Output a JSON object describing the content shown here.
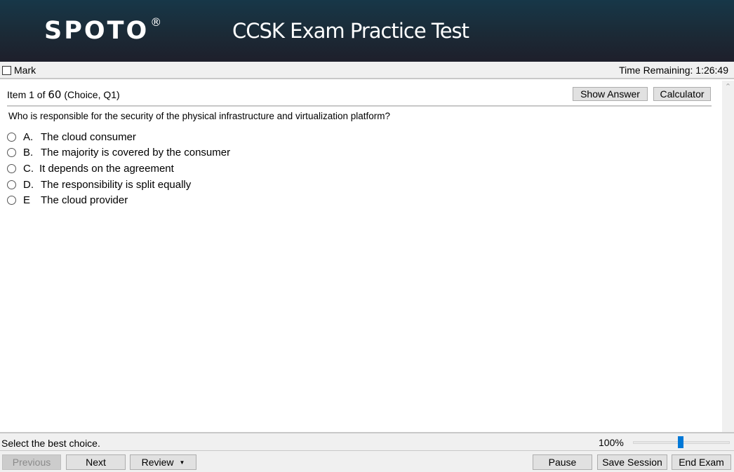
{
  "header": {
    "logo": "SPOTO",
    "logo_mark": "®",
    "title": "CCSK Exam Practice Test"
  },
  "markbar": {
    "mark_label": "Mark",
    "mark_checked": false,
    "time_remaining": "Time Remaining: 1:26:49"
  },
  "item": {
    "prefix": "Item 1 of",
    "total": "60",
    "suffix": "(Choice, Q1)",
    "show_answer_label": "Show Answer",
    "calculator_label": "Calculator"
  },
  "question": {
    "text": "Who is responsible for the security of the physical infrastructure and virtualization platform?",
    "options": [
      {
        "letter": "A.",
        "text": "The cloud consumer",
        "selected": false
      },
      {
        "letter": "B.",
        "text": "The majority is covered by the consumer",
        "selected": false
      },
      {
        "letter": "C.",
        "text": "It depends on the agreement",
        "selected": false
      },
      {
        "letter": "D.",
        "text": "The responsibility is split equally",
        "selected": false
      },
      {
        "letter": "E",
        "text": "The cloud provider",
        "selected": false
      }
    ]
  },
  "scrollbar": {
    "up_icon": "chevron-up-icon"
  },
  "status": {
    "hint": "Select the best choice.",
    "zoom": "100%"
  },
  "footer": {
    "previous_label": "Previous",
    "next_label": "Next",
    "review_label": "Review",
    "review_caret": "▼",
    "pause_label": "Pause",
    "save_label": "Save Session",
    "end_label": "End Exam"
  }
}
